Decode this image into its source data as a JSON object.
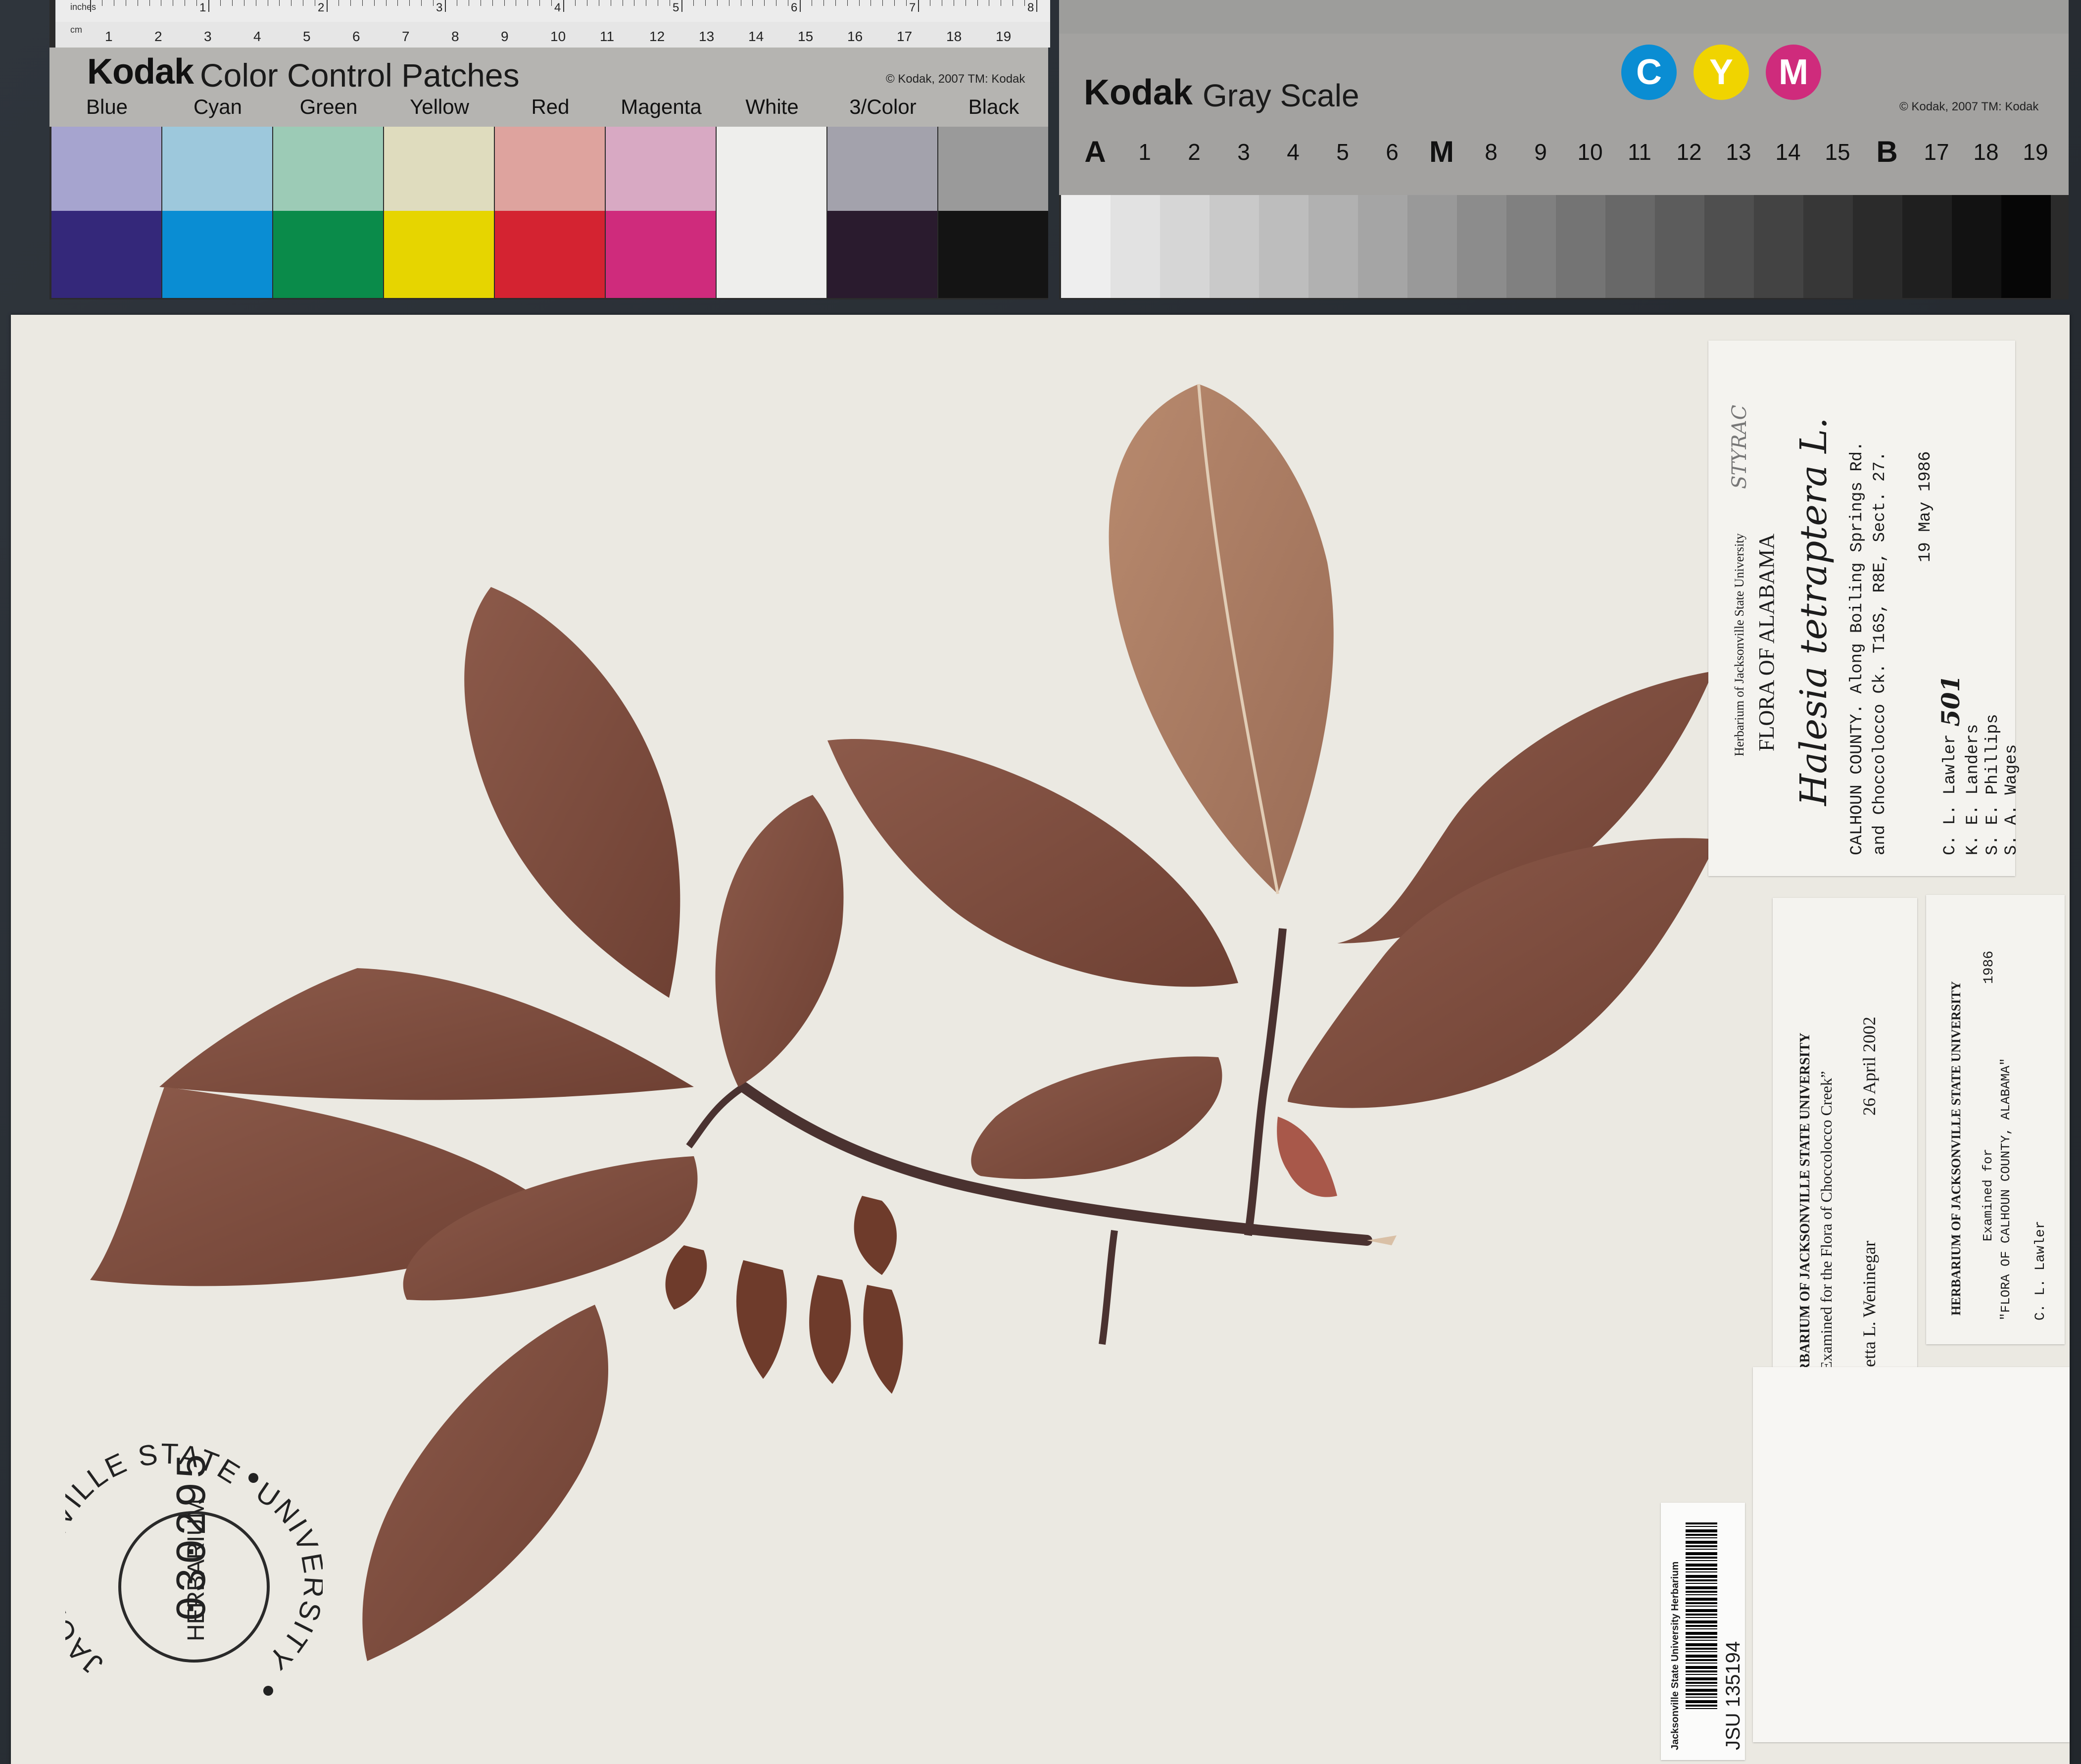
{
  "color_card": {
    "ruler_unit_inches": "inches",
    "ruler_unit_cm": "cm",
    "ruler_inch_numbers": [
      "1",
      "2",
      "3",
      "4",
      "5",
      "6",
      "7",
      "8"
    ],
    "ruler_cm_numbers": [
      "1",
      "2",
      "3",
      "4",
      "5",
      "6",
      "7",
      "8",
      "9",
      "10",
      "11",
      "12",
      "13",
      "14",
      "15",
      "16",
      "17",
      "18",
      "19"
    ],
    "brand": "Kodak",
    "title": "Color Control Patches",
    "copyright": "© Kodak, 2007  TM: Kodak",
    "patches": [
      {
        "label": "Blue",
        "top": "#a6a4cf",
        "bottom": "#34287a"
      },
      {
        "label": "Cyan",
        "top": "#9dc8dc",
        "bottom": "#0a8dd3"
      },
      {
        "label": "Green",
        "top": "#9ccbb6",
        "bottom": "#0a8b4a"
      },
      {
        "label": "Yellow",
        "top": "#dfdcbe",
        "bottom": "#e6d500"
      },
      {
        "label": "Red",
        "top": "#dea39e",
        "bottom": "#d42331"
      },
      {
        "label": "Magenta",
        "top": "#d8a9c3",
        "bottom": "#cf2b7c"
      },
      {
        "label": "White",
        "top": "#eeeeec",
        "bottom": "#eeeeec"
      },
      {
        "label": "3/Color",
        "top": "#a3a2ac",
        "bottom": "#2a1b2e"
      },
      {
        "label": "Black",
        "top": "#9a9a9a",
        "bottom": "#141414"
      }
    ]
  },
  "gray_card": {
    "brand": "Kodak",
    "title": "Gray Scale",
    "copyright": "© Kodak, 2007  TM: Kodak",
    "cym": [
      {
        "letter": "C",
        "color": "#0a8dd3"
      },
      {
        "letter": "Y",
        "color": "#f0d400"
      },
      {
        "letter": "M",
        "color": "#cf2b7c"
      }
    ],
    "steps": [
      "A",
      "1",
      "2",
      "3",
      "4",
      "5",
      "6",
      "M",
      "8",
      "9",
      "10",
      "11",
      "12",
      "13",
      "14",
      "15",
      "B",
      "17",
      "18",
      "19"
    ],
    "bold_steps": [
      "A",
      "M",
      "B"
    ]
  },
  "labels": {
    "main": {
      "institution": "Herbarium of Jacksonville State University",
      "handwritten_family": "STYRAC",
      "flora": "FLORA OF ALABAMA",
      "species": "Halesia tetraptera L.",
      "locality_1": "CALHOUN COUNTY.  Along Boiling Springs Rd.",
      "locality_2": "and Choccolocco Ck. T16S, R8E, Sect. 27.",
      "date": "19 May 1986",
      "collector_1": "C. L. Lawler",
      "collector_number": "501",
      "collector_2": "K. E. Landers",
      "collector_3": "S. E. Phillips",
      "collector_4": "S. A. Wages"
    },
    "annotation_2002": {
      "heading": "HERBARIUM OF JACKSONVILLE STATE UNIVERSITY",
      "examined": "“Examined for the Flora of Choccolocco Creek”",
      "examiner": "Loretta L. Weninegar",
      "date": "26 April 2002"
    },
    "annotation_1986": {
      "heading": "HERBARIUM OF JACKSONVILLE STATE UNIVERSITY",
      "examined": "Examined for",
      "project": "\"FLORA OF CALHOUN COUNTY, ALABAMA\"",
      "year": "1986",
      "examiner": "C. L. Lawler"
    },
    "barcode": {
      "institution": "Jacksonville State University Herbarium",
      "number": "JSU 135194"
    },
    "stamp_number": "030295",
    "round_stamp": {
      "top_arc": "JACKSONVILLE STATE",
      "center": "HERBARIUM",
      "side_arc": "UNIVERSITY"
    }
  }
}
